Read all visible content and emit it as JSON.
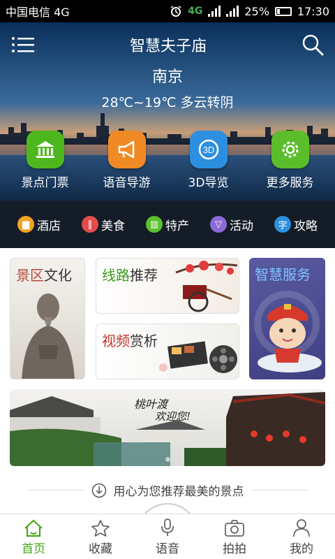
{
  "status_bar": {
    "carrier": "中国电信 4G",
    "net_4g": "4G",
    "net_2g": "4G 2G",
    "battery": "25%",
    "time": "17:30"
  },
  "header": {
    "title": "智慧夫子庙",
    "city": "南京",
    "weather": "28℃~19℃  多云转阴"
  },
  "features": [
    {
      "label": "景点门票",
      "color": "#4db81e",
      "icon": "ticket-building-icon"
    },
    {
      "label": "语音导游",
      "color": "#f08a24",
      "icon": "megaphone-icon"
    },
    {
      "label": "3D导览",
      "color": "#2d8fe0",
      "icon": "3d-icon"
    },
    {
      "label": "更多服务",
      "color": "#5cbd2a",
      "icon": "gear-icon"
    }
  ],
  "categories": [
    {
      "label": "酒店",
      "color": "#f2a223",
      "icon": "hotel-icon"
    },
    {
      "label": "美食",
      "color": "#e24c4c",
      "icon": "food-icon"
    },
    {
      "label": "特产",
      "color": "#5cc02c",
      "icon": "gift-icon"
    },
    {
      "label": "活动",
      "color": "#8a6ad6",
      "icon": "activity-icon"
    },
    {
      "label": "攻略",
      "color": "#2e8fe0",
      "icon": "guide-icon"
    }
  ],
  "cards": {
    "culture": {
      "part1": "景区",
      "part2": "文化"
    },
    "route": {
      "part1": "线路",
      "part2": "推荐"
    },
    "video": {
      "part1": "视频",
      "part2": "赏析"
    },
    "smart": {
      "label": "智慧服务"
    }
  },
  "banner": {
    "text1": "桃叶渡",
    "text2": "欢迎您!"
  },
  "recommend_text": "用心为您推荐最美的景点",
  "bottom_nav": [
    {
      "label": "首页",
      "icon": "home-icon",
      "active": true
    },
    {
      "label": "收藏",
      "icon": "star-icon",
      "active": false
    },
    {
      "label": "语音",
      "icon": "microphone-icon",
      "active": false
    },
    {
      "label": "拍拍",
      "icon": "camera-icon",
      "active": false
    },
    {
      "label": "我的",
      "icon": "user-icon",
      "active": false
    }
  ]
}
